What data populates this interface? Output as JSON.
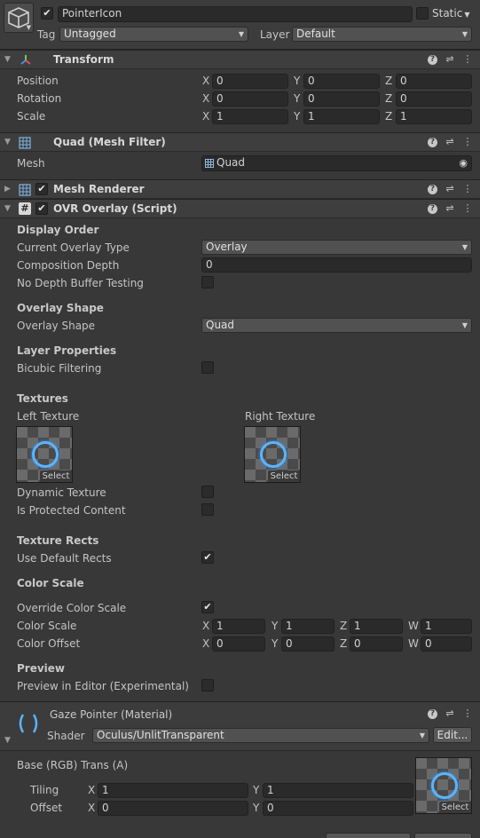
{
  "object": {
    "name": "PointerIcon",
    "active": true,
    "static_label": "Static",
    "tag_label": "Tag",
    "tag_value": "Untagged",
    "layer_label": "Layer",
    "layer_value": "Default"
  },
  "transform": {
    "title": "Transform",
    "rows": [
      {
        "label": "Position",
        "x": "0",
        "y": "0",
        "z": "0"
      },
      {
        "label": "Rotation",
        "x": "0",
        "y": "0",
        "z": "0"
      },
      {
        "label": "Scale",
        "x": "1",
        "y": "1",
        "z": "1"
      }
    ],
    "axis": {
      "x": "X",
      "y": "Y",
      "z": "Z",
      "w": "W"
    }
  },
  "mesh_filter": {
    "title": "Quad (Mesh Filter)",
    "mesh_label": "Mesh",
    "mesh_value": "Quad"
  },
  "mesh_renderer": {
    "title": "Mesh Renderer",
    "enabled": true
  },
  "ovr_overlay": {
    "title": "OVR Overlay (Script)",
    "enabled": true,
    "display_order": "Display Order",
    "current_overlay_type_label": "Current Overlay Type",
    "current_overlay_type_value": "Overlay",
    "composition_depth_label": "Composition Depth",
    "composition_depth_value": "0",
    "no_depth_buffer_label": "No Depth Buffer Testing",
    "overlay_shape_section": "Overlay Shape",
    "overlay_shape_label": "Overlay Shape",
    "overlay_shape_value": "Quad",
    "layer_properties": "Layer Properties",
    "bicubic_label": "Bicubic Filtering",
    "textures_section": "Textures",
    "left_texture_label": "Left Texture",
    "right_texture_label": "Right Texture",
    "select_label": "Select",
    "dynamic_texture_label": "Dynamic Texture",
    "protected_content_label": "Is Protected Content",
    "texture_rects_section": "Texture Rects",
    "use_default_rects_label": "Use Default Rects",
    "use_default_rects": true,
    "color_scale_section": "Color Scale",
    "override_color_scale_label": "Override Color Scale",
    "override_color_scale": true,
    "color_scale_label": "Color Scale",
    "color_scale": {
      "x": "1",
      "y": "1",
      "z": "1",
      "w": "1"
    },
    "color_offset_label": "Color Offset",
    "color_offset": {
      "x": "0",
      "y": "0",
      "z": "0",
      "w": "0"
    },
    "preview_section": "Preview",
    "preview_in_editor_label": "Preview in Editor (Experimental)"
  },
  "material": {
    "title": "Gaze Pointer (Material)",
    "shader_label": "Shader",
    "shader_value": "Oculus/UnlitTransparent",
    "edit_label": "Edit...",
    "base_label": "Base (RGB) Trans (A)",
    "tiling_label": "Tiling",
    "tiling": {
      "x": "1",
      "y": "1"
    },
    "offset_label": "Offset",
    "offset": {
      "x": "0",
      "y": "0"
    },
    "select_label": "Select"
  },
  "colors": {
    "background": "#383838",
    "header": "#3e3e3e",
    "field": "#2a2a2a",
    "accent_ring": "#5ab4ff"
  }
}
